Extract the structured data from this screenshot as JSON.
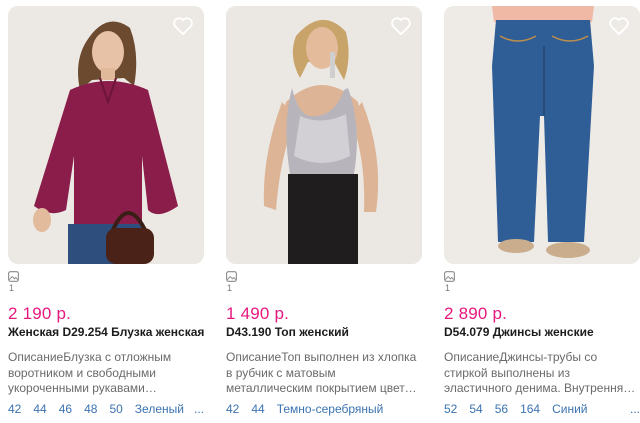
{
  "products": [
    {
      "price": "2 190 р.",
      "title": "Женская D29.254 Блузка женская",
      "description": "ОписаниеБлузка с отложным воротником и свободными укороченными рукавами выполнена из вискозной ткани.",
      "image_count": "1",
      "sizes": [
        "42",
        "44",
        "46",
        "48",
        "50"
      ],
      "color": "Зеленый",
      "more": "..."
    },
    {
      "price": "1 490 р.",
      "title": "D43.190 Топ женский",
      "description": "ОписаниеТоп выполнен из хлопка в рубчик с матовым металлическим покрытием цвета темное серебро. Модель приталенного силуэта.",
      "image_count": "1",
      "sizes": [
        "42",
        "44"
      ],
      "color": "Темно-серебряный",
      "more": ""
    },
    {
      "price": "2 890 р.",
      "title": "D54.079 Джинсы женские",
      "description": "ОписаниеДжинсы-трубы со стиркой выполнены из эластичного денима. Внутренняя сторона изделия выполнена из мягкого хлопка.",
      "image_count": "1",
      "sizes": [
        "52",
        "54",
        "56",
        "164"
      ],
      "color": "Синий",
      "more": "..."
    }
  ],
  "colors": {
    "price": "#e6177f",
    "link": "#3b73b0"
  },
  "icons": {
    "favorite": "heart-outline-icon",
    "image": "image-icon"
  }
}
